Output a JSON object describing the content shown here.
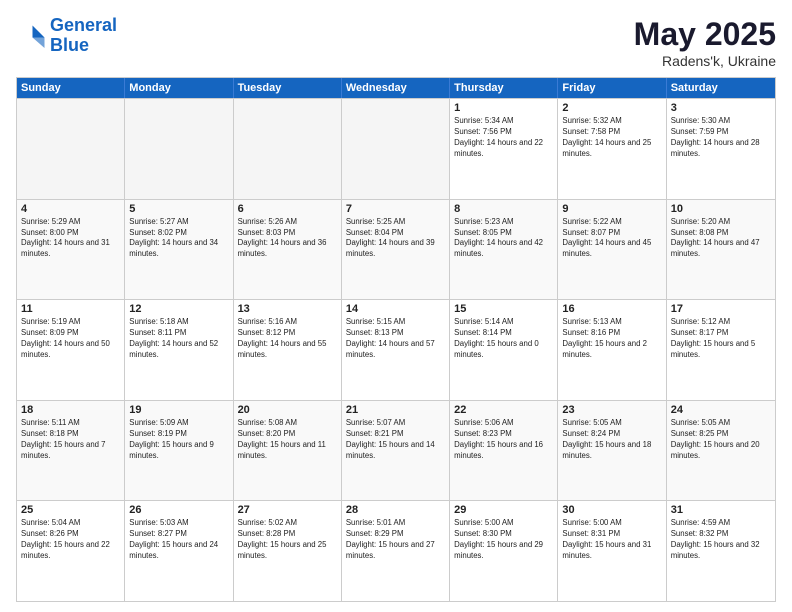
{
  "header": {
    "logo_line1": "General",
    "logo_line2": "Blue",
    "main_title": "May 2025",
    "subtitle": "Radens'k, Ukraine"
  },
  "days_of_week": [
    "Sunday",
    "Monday",
    "Tuesday",
    "Wednesday",
    "Thursday",
    "Friday",
    "Saturday"
  ],
  "weeks": [
    [
      {
        "day": "",
        "empty": true
      },
      {
        "day": "",
        "empty": true
      },
      {
        "day": "",
        "empty": true
      },
      {
        "day": "",
        "empty": true
      },
      {
        "day": "1",
        "sunrise": "Sunrise: 5:34 AM",
        "sunset": "Sunset: 7:56 PM",
        "daylight": "Daylight: 14 hours and 22 minutes."
      },
      {
        "day": "2",
        "sunrise": "Sunrise: 5:32 AM",
        "sunset": "Sunset: 7:58 PM",
        "daylight": "Daylight: 14 hours and 25 minutes."
      },
      {
        "day": "3",
        "sunrise": "Sunrise: 5:30 AM",
        "sunset": "Sunset: 7:59 PM",
        "daylight": "Daylight: 14 hours and 28 minutes."
      }
    ],
    [
      {
        "day": "4",
        "sunrise": "Sunrise: 5:29 AM",
        "sunset": "Sunset: 8:00 PM",
        "daylight": "Daylight: 14 hours and 31 minutes."
      },
      {
        "day": "5",
        "sunrise": "Sunrise: 5:27 AM",
        "sunset": "Sunset: 8:02 PM",
        "daylight": "Daylight: 14 hours and 34 minutes."
      },
      {
        "day": "6",
        "sunrise": "Sunrise: 5:26 AM",
        "sunset": "Sunset: 8:03 PM",
        "daylight": "Daylight: 14 hours and 36 minutes."
      },
      {
        "day": "7",
        "sunrise": "Sunrise: 5:25 AM",
        "sunset": "Sunset: 8:04 PM",
        "daylight": "Daylight: 14 hours and 39 minutes."
      },
      {
        "day": "8",
        "sunrise": "Sunrise: 5:23 AM",
        "sunset": "Sunset: 8:05 PM",
        "daylight": "Daylight: 14 hours and 42 minutes."
      },
      {
        "day": "9",
        "sunrise": "Sunrise: 5:22 AM",
        "sunset": "Sunset: 8:07 PM",
        "daylight": "Daylight: 14 hours and 45 minutes."
      },
      {
        "day": "10",
        "sunrise": "Sunrise: 5:20 AM",
        "sunset": "Sunset: 8:08 PM",
        "daylight": "Daylight: 14 hours and 47 minutes."
      }
    ],
    [
      {
        "day": "11",
        "sunrise": "Sunrise: 5:19 AM",
        "sunset": "Sunset: 8:09 PM",
        "daylight": "Daylight: 14 hours and 50 minutes."
      },
      {
        "day": "12",
        "sunrise": "Sunrise: 5:18 AM",
        "sunset": "Sunset: 8:11 PM",
        "daylight": "Daylight: 14 hours and 52 minutes."
      },
      {
        "day": "13",
        "sunrise": "Sunrise: 5:16 AM",
        "sunset": "Sunset: 8:12 PM",
        "daylight": "Daylight: 14 hours and 55 minutes."
      },
      {
        "day": "14",
        "sunrise": "Sunrise: 5:15 AM",
        "sunset": "Sunset: 8:13 PM",
        "daylight": "Daylight: 14 hours and 57 minutes."
      },
      {
        "day": "15",
        "sunrise": "Sunrise: 5:14 AM",
        "sunset": "Sunset: 8:14 PM",
        "daylight": "Daylight: 15 hours and 0 minutes."
      },
      {
        "day": "16",
        "sunrise": "Sunrise: 5:13 AM",
        "sunset": "Sunset: 8:16 PM",
        "daylight": "Daylight: 15 hours and 2 minutes."
      },
      {
        "day": "17",
        "sunrise": "Sunrise: 5:12 AM",
        "sunset": "Sunset: 8:17 PM",
        "daylight": "Daylight: 15 hours and 5 minutes."
      }
    ],
    [
      {
        "day": "18",
        "sunrise": "Sunrise: 5:11 AM",
        "sunset": "Sunset: 8:18 PM",
        "daylight": "Daylight: 15 hours and 7 minutes."
      },
      {
        "day": "19",
        "sunrise": "Sunrise: 5:09 AM",
        "sunset": "Sunset: 8:19 PM",
        "daylight": "Daylight: 15 hours and 9 minutes."
      },
      {
        "day": "20",
        "sunrise": "Sunrise: 5:08 AM",
        "sunset": "Sunset: 8:20 PM",
        "daylight": "Daylight: 15 hours and 11 minutes."
      },
      {
        "day": "21",
        "sunrise": "Sunrise: 5:07 AM",
        "sunset": "Sunset: 8:21 PM",
        "daylight": "Daylight: 15 hours and 14 minutes."
      },
      {
        "day": "22",
        "sunrise": "Sunrise: 5:06 AM",
        "sunset": "Sunset: 8:23 PM",
        "daylight": "Daylight: 15 hours and 16 minutes."
      },
      {
        "day": "23",
        "sunrise": "Sunrise: 5:05 AM",
        "sunset": "Sunset: 8:24 PM",
        "daylight": "Daylight: 15 hours and 18 minutes."
      },
      {
        "day": "24",
        "sunrise": "Sunrise: 5:05 AM",
        "sunset": "Sunset: 8:25 PM",
        "daylight": "Daylight: 15 hours and 20 minutes."
      }
    ],
    [
      {
        "day": "25",
        "sunrise": "Sunrise: 5:04 AM",
        "sunset": "Sunset: 8:26 PM",
        "daylight": "Daylight: 15 hours and 22 minutes."
      },
      {
        "day": "26",
        "sunrise": "Sunrise: 5:03 AM",
        "sunset": "Sunset: 8:27 PM",
        "daylight": "Daylight: 15 hours and 24 minutes."
      },
      {
        "day": "27",
        "sunrise": "Sunrise: 5:02 AM",
        "sunset": "Sunset: 8:28 PM",
        "daylight": "Daylight: 15 hours and 25 minutes."
      },
      {
        "day": "28",
        "sunrise": "Sunrise: 5:01 AM",
        "sunset": "Sunset: 8:29 PM",
        "daylight": "Daylight: 15 hours and 27 minutes."
      },
      {
        "day": "29",
        "sunrise": "Sunrise: 5:00 AM",
        "sunset": "Sunset: 8:30 PM",
        "daylight": "Daylight: 15 hours and 29 minutes."
      },
      {
        "day": "30",
        "sunrise": "Sunrise: 5:00 AM",
        "sunset": "Sunset: 8:31 PM",
        "daylight": "Daylight: 15 hours and 31 minutes."
      },
      {
        "day": "31",
        "sunrise": "Sunrise: 4:59 AM",
        "sunset": "Sunset: 8:32 PM",
        "daylight": "Daylight: 15 hours and 32 minutes."
      }
    ]
  ]
}
